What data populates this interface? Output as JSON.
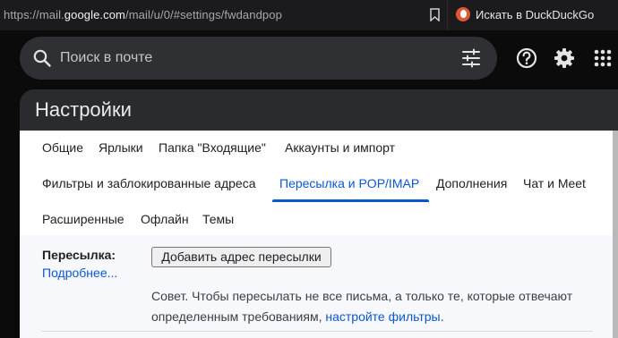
{
  "browser": {
    "url_prefix": "https://mail.",
    "url_domain": "google.com",
    "url_path": "/mail/u/0/#settings/fwdandpop",
    "search_engine_label": "Искать в DuckDuckGo"
  },
  "header": {
    "search_placeholder": "Поиск в почте",
    "icons": [
      "search-icon",
      "tune-icon",
      "help-icon",
      "gear-icon",
      "apps-icon"
    ]
  },
  "settings": {
    "title": "Настройки",
    "tabs_row1": [
      "Общие",
      "Ярлыки",
      "Папка \"Входящие\"",
      "Аккаунты и импорт"
    ],
    "tabs_row2": [
      "Фильтры и заблокированные адреса",
      "Пересылка и POP/IMAP",
      "Дополнения",
      "Чат и Meet"
    ],
    "tabs_row3": [
      "Расширенные",
      "Офлайн",
      "Темы"
    ],
    "active_tab": "Пересылка и POP/IMAP"
  },
  "forwarding": {
    "label": "Пересылка:",
    "more_link": "Подробнее...",
    "add_button": "Добавить адрес пересылки",
    "tip_line1": "Совет. Чтобы пересылать не все письма, а только те, которые отвечают",
    "tip_line2_prefix": "определенным требованиям, ",
    "tip_link": "настройте фильтры",
    "tip_suffix": "."
  },
  "colors": {
    "accent": "#0b57d0",
    "panel_dark": "#2a2b2e",
    "search_bg": "#2f3033"
  }
}
